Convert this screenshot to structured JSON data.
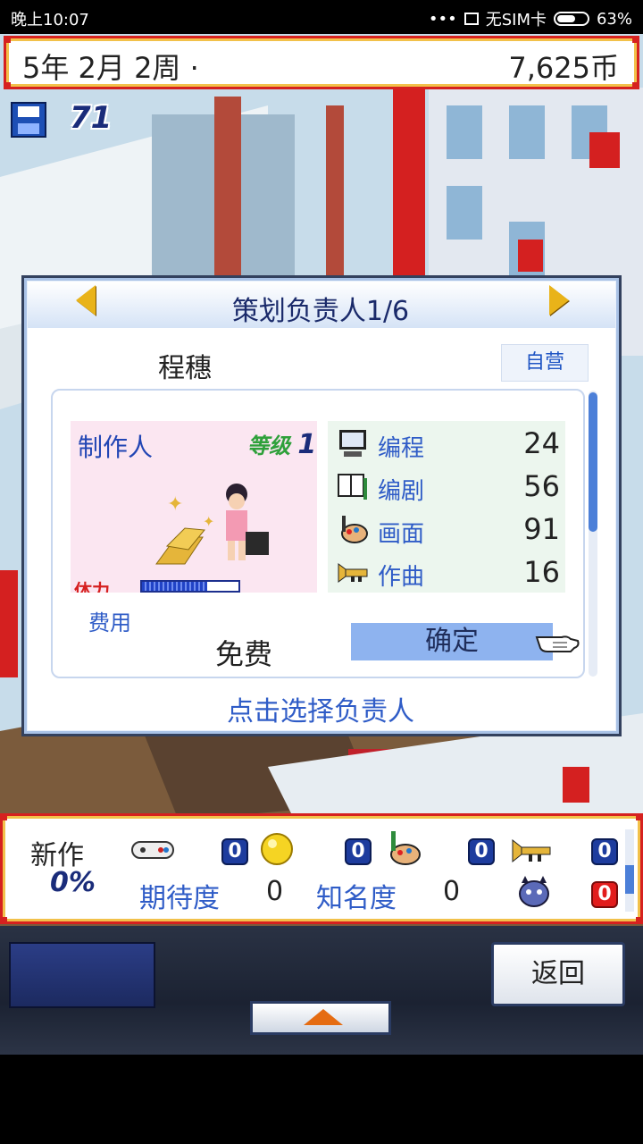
{
  "status_bar": {
    "time": "晚上10:07",
    "dots": "•••",
    "sim": "无SIM卡",
    "battery": "63%",
    "battery_level": 0.63
  },
  "top_bar": {
    "date": "5年 2月 2周 ·",
    "money": "7,625币"
  },
  "save": {
    "icon": "floppy-disk-icon",
    "count": "71"
  },
  "dialog": {
    "title": "策划负责人1/6",
    "name": "程穗",
    "company": "自营",
    "role": "制作人",
    "level_label": "等级",
    "level_value": "1",
    "stamina_label": "体力",
    "stamina_level": 0.68,
    "stats": [
      {
        "icon": "computer-icon",
        "label": "编程",
        "value": "24"
      },
      {
        "icon": "book-icon",
        "label": "编剧",
        "value": "56"
      },
      {
        "icon": "paint-icon",
        "label": "画面",
        "value": "91"
      },
      {
        "icon": "trumpet-icon",
        "label": "作曲",
        "value": "16"
      }
    ],
    "fee_label": "费用",
    "fee_value": "免费",
    "confirm": "确定",
    "hint": "点击选择负责人"
  },
  "bottom_bar": {
    "new_label": "新作",
    "new_pct": "0%",
    "counts": [
      "0",
      "0",
      "0",
      "0",
      "0"
    ],
    "expect_label": "期待度",
    "expect_value": "0",
    "fame_label": "知名度",
    "fame_value": "0"
  },
  "nav": {
    "back": "返回"
  },
  "colors": {
    "accent_red": "#d6211f",
    "gold": "#f2c14a",
    "title_blue": "#1a2a6a",
    "label_blue": "#2f5cc7"
  }
}
